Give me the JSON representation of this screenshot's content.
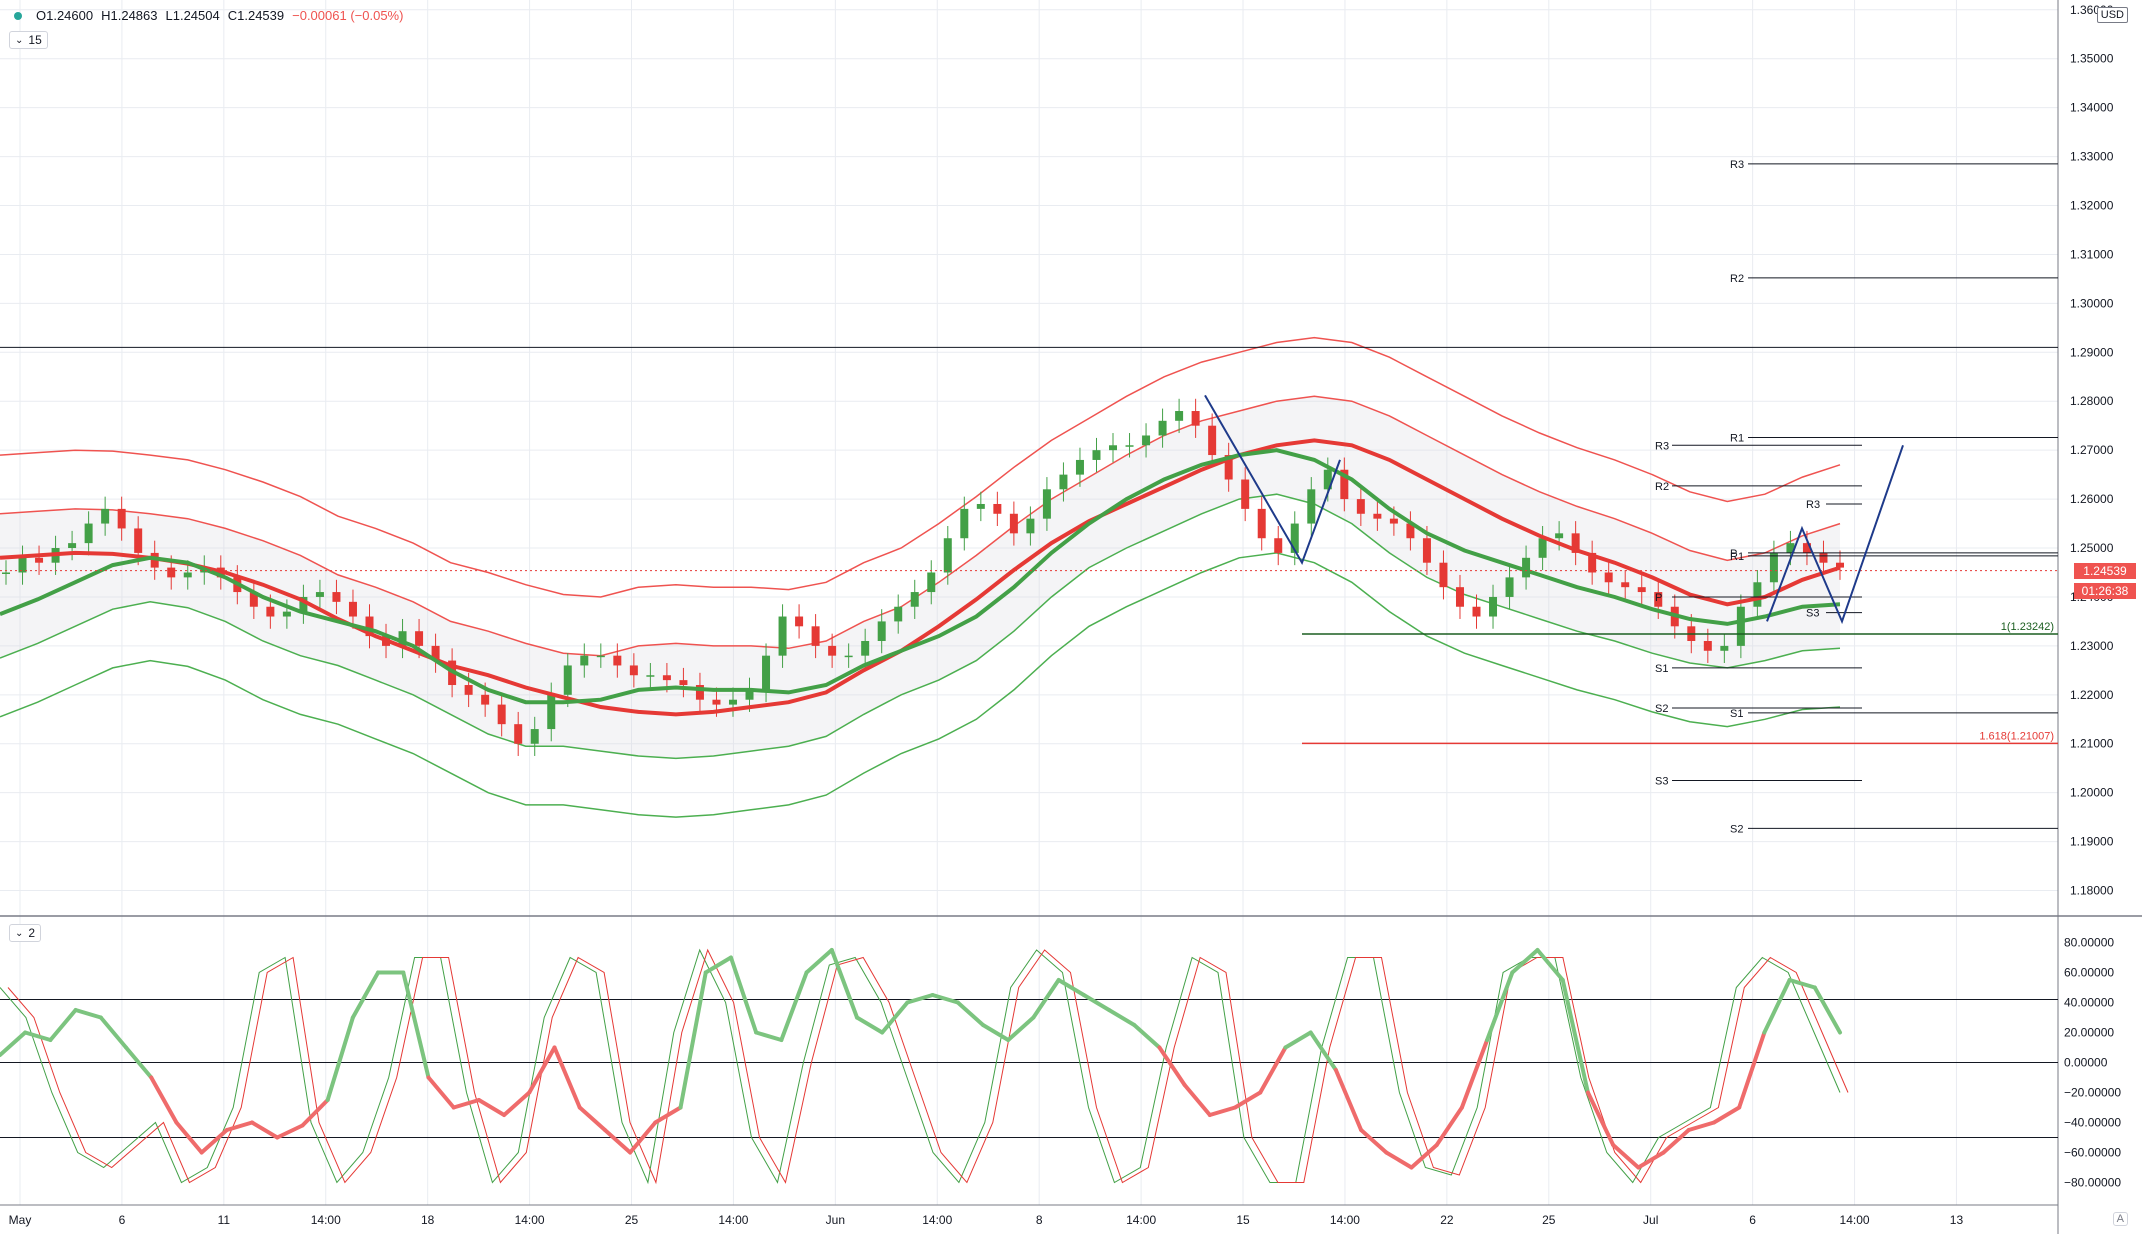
{
  "legend": {
    "open": "O1.24600",
    "high": "H1.24863",
    "low": "L1.24504",
    "close": "C1.24539",
    "change": "−0.00061 (−0.05%)"
  },
  "top_pane_button": "15",
  "bottom_pane_button": "2",
  "currency_badge": "USD",
  "last_price": "1.24539",
  "countdown": "01:26:38",
  "auto_button": "A",
  "colors": {
    "bull": "#43a047",
    "bear": "#e53935",
    "red_band": "#ef5350",
    "green_band": "#4caf50",
    "drawing_blue": "#1e3a8a",
    "grid": "#e9ecf1"
  },
  "chart_data": [
    {
      "type": "candlestick",
      "symbol_note": "price chart with two moving averages and envelopes",
      "ylim": [
        1.175,
        1.362
      ],
      "y_ticks": [
        "1.36000",
        "1.35000",
        "1.34000",
        "1.33000",
        "1.32000",
        "1.31000",
        "1.30000",
        "1.29000",
        "1.28000",
        "1.27000",
        "1.26000",
        "1.25000",
        "1.24000",
        "1.23000",
        "1.22000",
        "1.21000",
        "1.20000",
        "1.19000",
        "1.18000"
      ],
      "x_ticks": [
        "May",
        "6",
        "11",
        "14:00",
        "18",
        "14:00",
        "25",
        "14:00",
        "Jun",
        "14:00",
        "8",
        "14:00",
        "15",
        "14:00",
        "22",
        "25",
        "Jul",
        "6",
        "14:00",
        "13"
      ],
      "close_series": [
        1.245,
        1.248,
        1.247,
        1.25,
        1.251,
        1.255,
        1.258,
        1.254,
        1.249,
        1.246,
        1.244,
        1.245,
        1.246,
        1.244,
        1.241,
        1.238,
        1.236,
        1.237,
        1.24,
        1.241,
        1.239,
        1.236,
        1.232,
        1.23,
        1.233,
        1.23,
        1.227,
        1.222,
        1.22,
        1.218,
        1.214,
        1.21,
        1.213,
        1.22,
        1.226,
        1.228,
        1.228,
        1.226,
        1.224,
        1.224,
        1.223,
        1.222,
        1.219,
        1.218,
        1.219,
        1.221,
        1.228,
        1.236,
        1.234,
        1.23,
        1.228,
        1.228,
        1.231,
        1.235,
        1.238,
        1.241,
        1.245,
        1.252,
        1.258,
        1.259,
        1.257,
        1.253,
        1.256,
        1.262,
        1.265,
        1.268,
        1.27,
        1.271,
        1.271,
        1.273,
        1.276,
        1.278,
        1.275,
        1.269,
        1.264,
        1.258,
        1.252,
        1.249,
        1.255,
        1.262,
        1.266,
        1.26,
        1.257,
        1.256,
        1.255,
        1.252,
        1.247,
        1.242,
        1.238,
        1.236,
        1.24,
        1.244,
        1.248,
        1.252,
        1.253,
        1.249,
        1.245,
        1.243,
        1.242,
        1.241,
        1.238,
        1.234,
        1.231,
        1.229,
        1.23,
        1.238,
        1.243,
        1.249,
        1.251,
        1.249,
        1.247,
        1.246
      ],
      "moving_average_red": [
        1.248,
        1.2485,
        1.249,
        1.2488,
        1.248,
        1.2468,
        1.245,
        1.2425,
        1.2395,
        1.2355,
        1.232,
        1.229,
        1.226,
        1.224,
        1.2215,
        1.2195,
        1.2175,
        1.2165,
        1.216,
        1.2165,
        1.2175,
        1.2185,
        1.2205,
        1.225,
        1.229,
        1.234,
        1.2395,
        1.2455,
        1.251,
        1.2555,
        1.259,
        1.2625,
        1.266,
        1.269,
        1.271,
        1.272,
        1.271,
        1.268,
        1.264,
        1.26,
        1.256,
        1.2525,
        1.2495,
        1.247,
        1.244,
        1.2405,
        1.2385,
        1.24,
        1.2435,
        1.246
      ],
      "moving_average_green": [
        1.2365,
        1.2395,
        1.243,
        1.2465,
        1.248,
        1.247,
        1.244,
        1.24,
        1.237,
        1.235,
        1.233,
        1.23,
        1.225,
        1.221,
        1.2185,
        1.2185,
        1.219,
        1.221,
        1.2215,
        1.221,
        1.221,
        1.2205,
        1.222,
        1.226,
        1.229,
        1.232,
        1.236,
        1.242,
        1.249,
        1.255,
        1.26,
        1.264,
        1.267,
        1.269,
        1.27,
        1.268,
        1.264,
        1.258,
        1.253,
        1.2495,
        1.247,
        1.2445,
        1.242,
        1.24,
        1.2375,
        1.2355,
        1.2345,
        1.236,
        1.238,
        1.2385
      ],
      "levels": [
        {
          "label": "R3",
          "value": 1.3285
        },
        {
          "label": "R2",
          "value": 1.3052
        },
        {
          "label": "R1",
          "value": 1.2726
        },
        {
          "label": "R3",
          "value": 1.271
        },
        {
          "label": "R2",
          "value": 1.2627
        },
        {
          "label": "R3",
          "value": 1.259
        },
        {
          "label": "R1",
          "value": 1.2484
        },
        {
          "label": "P",
          "value": 1.249
        },
        {
          "label": "P",
          "value": 1.24
        },
        {
          "label": "S3",
          "value": 1.2368
        },
        {
          "label": "S1",
          "value": 1.2255
        },
        {
          "label": "S2",
          "value": 1.2173
        },
        {
          "label": "S1",
          "value": 1.2163
        },
        {
          "label": "S3",
          "value": 1.2025
        },
        {
          "label": "S2",
          "value": 1.1927
        }
      ],
      "horizontal_line": 1.291,
      "fib_levels": [
        {
          "label": "1(1.23242)",
          "value": 1.23242
        },
        {
          "label": "1.618(1.21007)",
          "value": 1.21007
        }
      ],
      "last_price": 1.24539
    },
    {
      "type": "line",
      "name_note": "oscillator pane",
      "ylim": [
        -95,
        95
      ],
      "y_ticks": [
        "80.00000",
        "60.00000",
        "40.00000",
        "20.00000",
        "0.00000",
        "−20.00000",
        "−40.00000",
        "−60.00000",
        "−80.00000"
      ],
      "reference_lines": [
        42,
        0,
        -50
      ],
      "main_line": [
        5,
        20,
        15,
        35,
        30,
        10,
        -10,
        -40,
        -60,
        -45,
        -40,
        -50,
        -42,
        -25,
        30,
        60,
        60,
        -10,
        -30,
        -25,
        -35,
        -20,
        10,
        -30,
        -45,
        -60,
        -40,
        -30,
        60,
        70,
        20,
        15,
        60,
        75,
        30,
        20,
        40,
        45,
        40,
        25,
        15,
        30,
        55,
        45,
        35,
        25,
        10,
        -15,
        -35,
        -30,
        -20,
        10,
        20,
        -5,
        -45,
        -60,
        -70,
        -55,
        -30,
        15,
        60,
        75,
        55,
        -20,
        -55,
        -70,
        -60,
        -45,
        -40,
        -30,
        20,
        55,
        50,
        20
      ],
      "fast_line": [
        50,
        30,
        -20,
        -60,
        -70,
        -55,
        -40,
        -80,
        -70,
        -30,
        60,
        70,
        -40,
        -80,
        -60,
        -10,
        70,
        70,
        -20,
        -80,
        -60,
        30,
        70,
        60,
        -40,
        -80,
        20,
        75,
        40,
        -50,
        -80,
        0,
        65,
        70,
        40,
        -10,
        -60,
        -80,
        -40,
        50,
        75,
        60,
        -30,
        -80,
        -70,
        10,
        70,
        60,
        -50,
        -80,
        -80,
        10,
        70,
        70,
        -20,
        -70,
        -75,
        -30,
        60,
        70,
        70,
        -10,
        -60,
        -80,
        -50,
        -40,
        -30,
        50,
        70,
        60,
        20,
        -20
      ]
    }
  ]
}
